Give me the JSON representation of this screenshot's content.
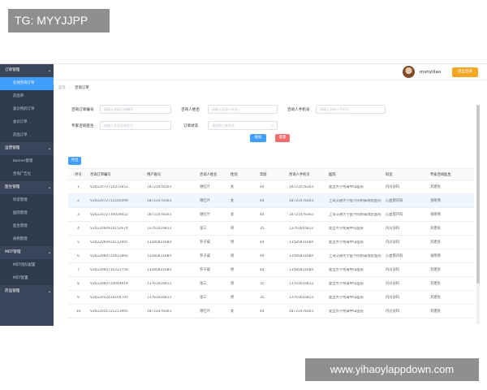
{
  "watermark_top": "TG: MYYJJPP",
  "watermark_bottom": "www.yihaoylappdown.com",
  "sidebar": {
    "groups": [
      {
        "label": "订单管理",
        "items": [
          "在线咨询订单",
          "药品单",
          "复诊用药订单",
          "会诊订单",
          "药品订单"
        ]
      },
      {
        "label": "运营管理",
        "items": [
          "banner管理",
          "咨询广告位"
        ]
      },
      {
        "label": "医生管理",
        "items": [
          "科室管理",
          "医院管理",
          "医生管理",
          "病例管理"
        ]
      },
      {
        "label": "MDT管理",
        "items": [
          "MDT团队配置",
          "MDT配置"
        ]
      },
      {
        "label": "药品管理",
        "items": []
      }
    ]
  },
  "header": {
    "username": "mshyiliao",
    "button_label": "退出登录"
  },
  "tabs": [
    "首页",
    "咨询订单"
  ],
  "filters": {
    "order_no_label": "咨询订单编号",
    "order_no_placeholder": "请输入咨询订单编号",
    "consultant_label": "咨询人姓名",
    "consultant_placeholder": "请输入咨询人姓名",
    "phone_label": "咨询人手机号",
    "phone_placeholder": "请输入咨询人手机号",
    "doctor_label": "专家咨询医生",
    "doctor_placeholder": "请输入专家咨询医生",
    "status_label": "订单状态",
    "status_placeholder": "请选择订单状态"
  },
  "buttons": {
    "search": "搜索",
    "reset": "重置",
    "export": "导出"
  },
  "table": {
    "columns": [
      "序号",
      "咨询订单编号",
      "用户账号",
      "咨询人姓名",
      "性别",
      "年龄",
      "咨询人手机号",
      "医院",
      "科室",
      "专家咨询医生"
    ],
    "rows": [
      [
        "1",
        "V2022072714372652",
        "18721478303",
        "谢红叶",
        "女",
        "44",
        "18721478303",
        "复旦大学附属中山医院",
        "内分泌科",
        "刘建民"
      ],
      [
        "2",
        "V2022072711505499",
        "18721478303",
        "谢红叶",
        "女",
        "44",
        "18721478303",
        "上海交通大学医学院附属瑞金医院",
        "心血管内科",
        "张晓燕"
      ],
      [
        "3",
        "V2022072716024052",
        "18721478303",
        "谢红叶",
        "女",
        "44",
        "18721478303",
        "上海交通大学医学院附属瑞金医院",
        "心血管内科",
        "张晓燕"
      ],
      [
        "4",
        "V2022060914152674",
        "13761616813",
        "张三",
        "男",
        "35",
        "13761616813",
        "复旦大学附属中山医院",
        "内分泌科",
        "刘建民"
      ],
      [
        "5",
        "V2022060914112945",
        "13585831684",
        "罗子威",
        "男",
        "44",
        "13585831684",
        "复旦大学附属中山医院",
        "内分泌科",
        "刘建民"
      ],
      [
        "6",
        "V2022060710431892",
        "13585831684",
        "罗子威",
        "男",
        "49",
        "13585831684",
        "上海交通大学医学院附属瑞金医院",
        "心血管内科",
        "张晓燕"
      ],
      [
        "7",
        "V2022060710323756",
        "13585831684",
        "罗子威",
        "男",
        "44",
        "13585831684",
        "复旦大学附属中山医院",
        "内分泌科",
        "刘建民"
      ],
      [
        "8",
        "V2022060710044919",
        "13761616813",
        "张三",
        "男",
        "35",
        "13761616813",
        "复旦大学附属中山医院",
        "内分泌科",
        "刘建民"
      ],
      [
        "9",
        "V2022052416104791",
        "13761616813",
        "张三",
        "男",
        "35",
        "13761616813",
        "复旦大学附属中山医院",
        "内分泌科",
        "刘建民"
      ],
      [
        "10",
        "V2022051511213995",
        "18721478303",
        "谢红叶",
        "女",
        "44",
        "18721478303",
        "复旦大学附属中山医院",
        "内分泌科",
        "刘建民"
      ]
    ]
  },
  "colors": {
    "sidebar_bg": "#3a4559",
    "accent": "#409eff",
    "danger": "#f56c6c",
    "header_button": "#f5a623"
  }
}
